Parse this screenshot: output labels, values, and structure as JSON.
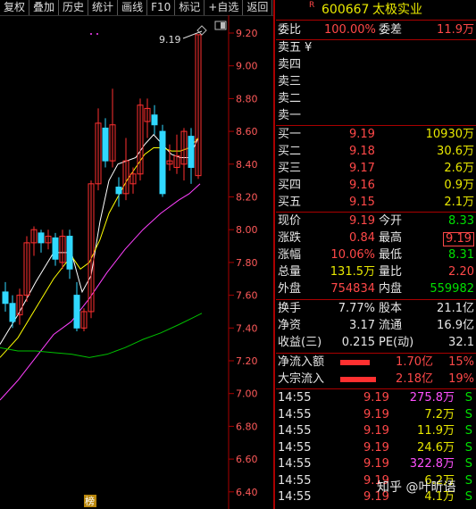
{
  "toolbar": {
    "items": [
      "复权",
      "叠加",
      "历史",
      "统计",
      "画线",
      "F10",
      "标记",
      "+自选",
      "返回"
    ]
  },
  "chart": {
    "price_ticks": [
      "9.20",
      "9.00",
      "8.80",
      "8.60",
      "8.40",
      "8.20",
      "8.00",
      "7.80",
      "7.60",
      "7.40",
      "7.20",
      "7.00",
      "6.80",
      "6.60",
      "6.40"
    ],
    "max_annotation": "9.19",
    "badge": "榜",
    "colors": {
      "up": "#ff3030",
      "down": "#30d8ff",
      "ma5": "#ffffff",
      "ma10": "#ffff00",
      "ma20": "#ff40ff",
      "ma60": "#00c000"
    }
  },
  "quote": {
    "badge": "R",
    "code": "600667",
    "name": "太极实业",
    "weibi_label": "委比",
    "weibi_value": "100.00%",
    "weicha_label": "委差",
    "weicha_value": "11.9万",
    "sell": [
      {
        "label": "卖五",
        "price": "¥",
        "vol": ""
      },
      {
        "label": "卖四",
        "price": "",
        "vol": ""
      },
      {
        "label": "卖三",
        "price": "",
        "vol": ""
      },
      {
        "label": "卖二",
        "price": "",
        "vol": ""
      },
      {
        "label": "卖一",
        "price": "",
        "vol": ""
      }
    ],
    "buy": [
      {
        "label": "买一",
        "price": "9.19",
        "vol": "10930万"
      },
      {
        "label": "买二",
        "price": "9.18",
        "vol": "30.6万"
      },
      {
        "label": "买三",
        "price": "9.17",
        "vol": "2.6万"
      },
      {
        "label": "买四",
        "price": "9.16",
        "vol": "0.9万"
      },
      {
        "label": "买五",
        "price": "9.15",
        "vol": "2.1万"
      }
    ],
    "stats": [
      {
        "l1": "现价",
        "v1": "9.19",
        "l2": "今开",
        "v2": "8.33"
      },
      {
        "l1": "涨跌",
        "v1": "0.84",
        "l2": "最高",
        "v2": "9.19"
      },
      {
        "l1": "涨幅",
        "v1": "10.06%",
        "l2": "最低",
        "v2": "8.31"
      },
      {
        "l1": "总量",
        "v1": "131.5万",
        "l2": "量比",
        "v2": "2.20"
      },
      {
        "l1": "外盘",
        "v1": "754834",
        "l2": "内盘",
        "v2": "559982"
      }
    ],
    "stats2": [
      {
        "l1": "换手",
        "v1": "7.77%",
        "l2": "股本",
        "v2": "21.1亿"
      },
      {
        "l1": "净资",
        "v1": "3.17",
        "l2": "流通",
        "v2": "16.9亿"
      },
      {
        "l1": "收益(三)",
        "v1": "0.215",
        "l2": "PE(动)",
        "v2": "32.1"
      }
    ],
    "flow": [
      {
        "label": "净流入额",
        "value": "1.70亿",
        "pct": "15%",
        "bar": 0.65
      },
      {
        "label": "大宗流入",
        "value": "2.18亿",
        "pct": "19%",
        "bar": 0.8
      }
    ],
    "ticks": [
      {
        "time": "14:55",
        "price": "9.19",
        "vol": "275.8万",
        "side": "S"
      },
      {
        "time": "14:55",
        "price": "9.19",
        "vol": "7.2万",
        "side": "S"
      },
      {
        "time": "14:55",
        "price": "9.19",
        "vol": "11.9万",
        "side": "S"
      },
      {
        "time": "14:55",
        "price": "9.19",
        "vol": "24.6万",
        "side": "S"
      },
      {
        "time": "14:55",
        "price": "9.19",
        "vol": "322.8万",
        "side": "S"
      },
      {
        "time": "14:55",
        "price": "9.19",
        "vol": "6.2万",
        "side": "S"
      },
      {
        "time": "14:55",
        "price": "9.19",
        "vol": "4.1万",
        "side": "S"
      }
    ]
  },
  "watermark": "知乎 @叶昕语"
}
